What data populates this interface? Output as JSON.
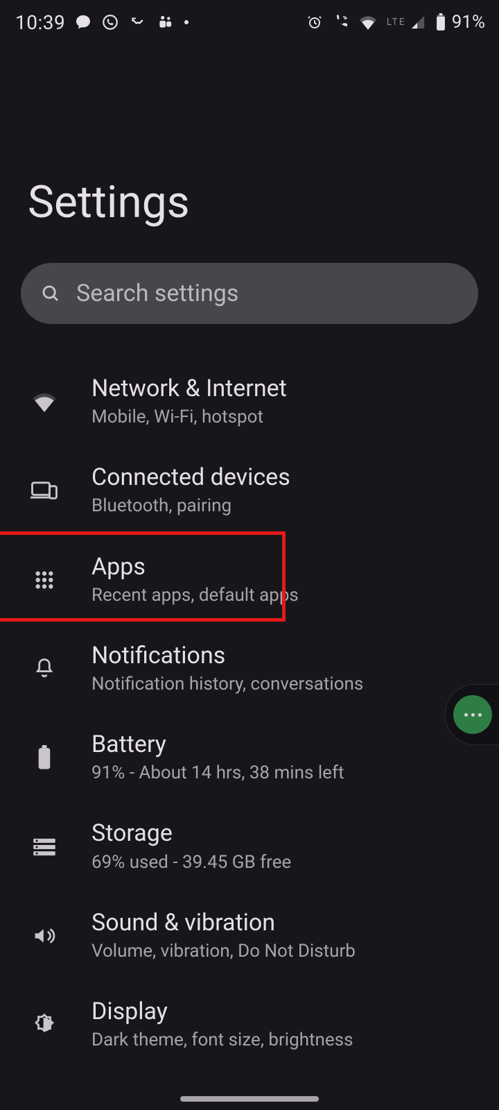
{
  "status_bar": {
    "time": "10:39",
    "lte": "LTE",
    "battery_pct": "91%"
  },
  "title": "Settings",
  "search": {
    "placeholder": "Search settings"
  },
  "items": [
    {
      "key": "network",
      "title": "Network & Internet",
      "sub": "Mobile, Wi-Fi, hotspot"
    },
    {
      "key": "connected",
      "title": "Connected devices",
      "sub": "Bluetooth, pairing"
    },
    {
      "key": "apps",
      "title": "Apps",
      "sub": "Recent apps, default apps"
    },
    {
      "key": "notifications",
      "title": "Notifications",
      "sub": "Notification history, conversations"
    },
    {
      "key": "battery",
      "title": "Battery",
      "sub": "91% - About 14 hrs, 38 mins left"
    },
    {
      "key": "storage",
      "title": "Storage",
      "sub": "69% used - 39.45 GB free"
    },
    {
      "key": "sound",
      "title": "Sound & vibration",
      "sub": "Volume, vibration, Do Not Disturb"
    },
    {
      "key": "display",
      "title": "Display",
      "sub": "Dark theme, font size, brightness"
    }
  ],
  "highlight_item_key": "apps"
}
